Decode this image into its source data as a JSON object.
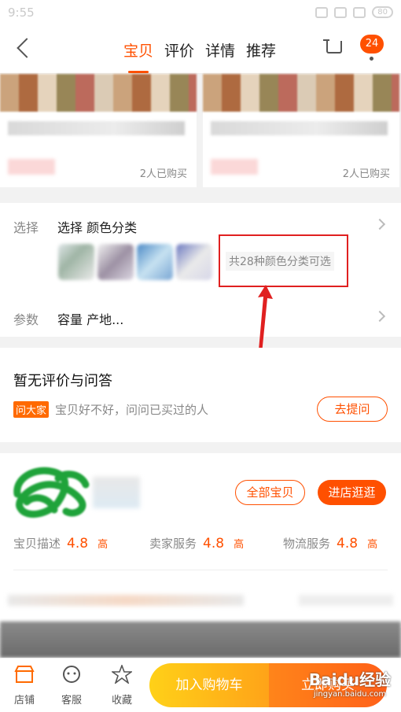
{
  "status_bar": {
    "time": "9:55",
    "battery": "80"
  },
  "nav": {
    "tabs": [
      "宝贝",
      "评价",
      "详情",
      "推荐"
    ],
    "active_tab": "宝贝",
    "badge_count": "24"
  },
  "products": [
    {
      "sold": "2人已购买"
    },
    {
      "sold": "2人已购买"
    }
  ],
  "options": {
    "select_label": "选择",
    "select_value": "选择 颜色分类",
    "color_count_text": "共28种颜色分类可选",
    "params_label": "参数",
    "params_value": "容量 产地..."
  },
  "reviews": {
    "title": "暂无评价与问答",
    "ask_tag": "问大家",
    "ask_text": "宝贝好不好，问问已买过的人",
    "ask_button": "去提问"
  },
  "shop": {
    "all_items_button": "全部宝贝",
    "visit_button": "进店逛逛",
    "scores": [
      {
        "label": "宝贝描述",
        "value": "4.8",
        "level": "高"
      },
      {
        "label": "卖家服务",
        "value": "4.8",
        "level": "高"
      },
      {
        "label": "物流服务",
        "value": "4.8",
        "level": "高"
      }
    ]
  },
  "bottom_bar": {
    "shop_label": "店铺",
    "service_label": "客服",
    "favorite_label": "收藏",
    "add_to_cart": "加入购物车",
    "buy_now": "立即购买"
  },
  "watermark": {
    "main": "Baidu经验",
    "sub": "jingyan.baidu.com"
  },
  "colors": {
    "accent": "#ff5000",
    "highlight_box": "#e02020"
  }
}
